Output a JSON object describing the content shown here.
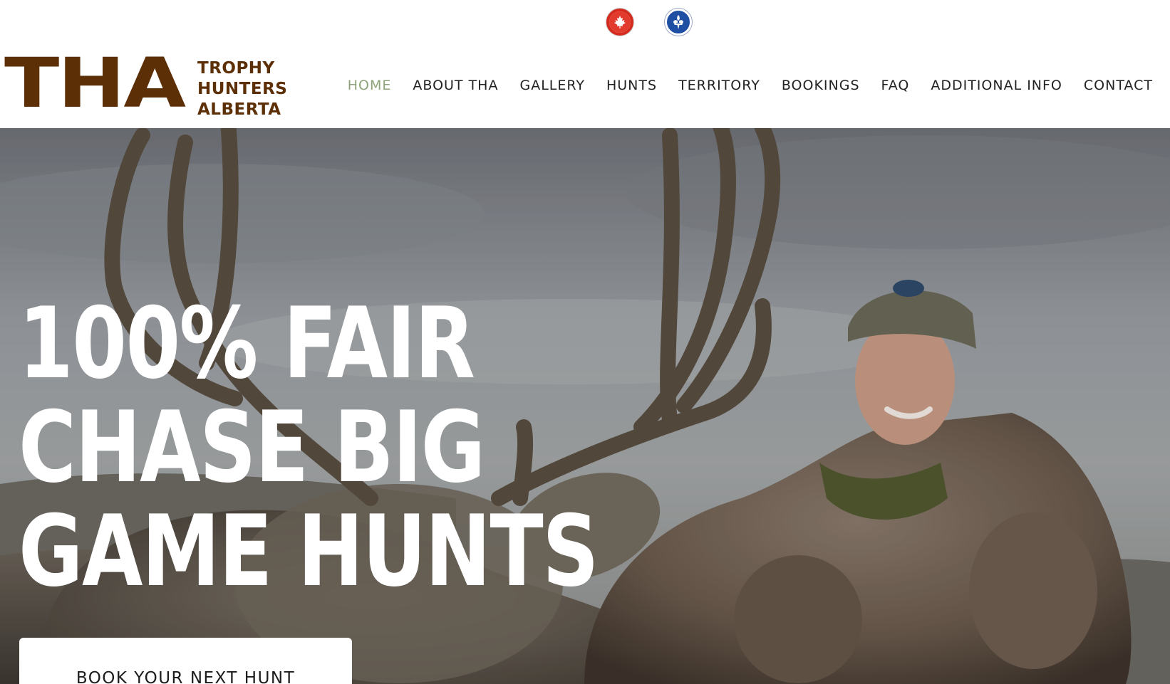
{
  "language_flags": [
    {
      "name": "Canada",
      "icon": "canada-flag-icon"
    },
    {
      "name": "Quebec",
      "icon": "quebec-flag-icon"
    }
  ],
  "logo": {
    "mark": "THA",
    "line1": "TROPHY",
    "line2": "HUNTERS",
    "line3": "ALBERTA",
    "color": "#5c2f06"
  },
  "nav": {
    "active_color": "#8fa37a",
    "items": [
      {
        "label": "HOME",
        "active": true
      },
      {
        "label": "ABOUT THA",
        "active": false
      },
      {
        "label": "GALLERY",
        "active": false
      },
      {
        "label": "HUNTS",
        "active": false
      },
      {
        "label": "TERRITORY",
        "active": false
      },
      {
        "label": "BOOKINGS",
        "active": false
      },
      {
        "label": "FAQ",
        "active": false
      },
      {
        "label": "ADDITIONAL INFO",
        "active": false
      },
      {
        "label": "CONTACT",
        "active": false
      }
    ]
  },
  "hero": {
    "headline_lines": [
      "100% FAIR",
      "CHASE BIG",
      "GAME HUNTS"
    ],
    "cta_label": "BOOK YOUR NEXT HUNT"
  }
}
